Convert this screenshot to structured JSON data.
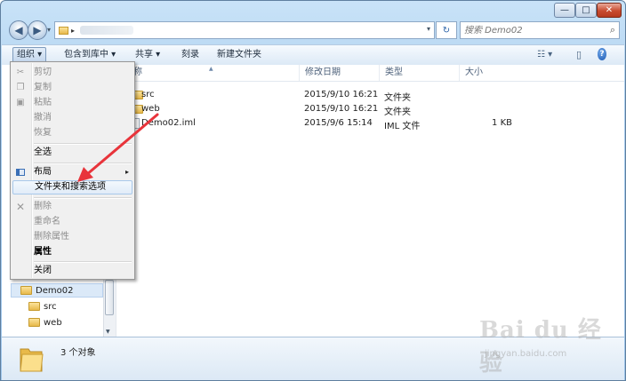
{
  "window": {
    "minimize_glyph": "—",
    "maximize_glyph": "□",
    "close_glyph": "✕"
  },
  "address_bar": {
    "path_arrow": "▸",
    "history_dropdown": "▾",
    "refresh_glyph": "↻"
  },
  "search": {
    "placeholder": "搜索 Demo02",
    "icon": "search-icon"
  },
  "toolbar": {
    "organize": "组织 ▾",
    "include_in_library": "包含到库中 ▾",
    "share": "共享 ▾",
    "burn": "刻录",
    "new_folder": "新建文件夹",
    "view_glyph": "☷ ▾",
    "preview_glyph": "▯",
    "help_glyph": "?"
  },
  "columns": {
    "name": "称",
    "date_modified": "修改日期",
    "type": "类型",
    "size": "大小"
  },
  "files": [
    {
      "name": "src",
      "date": "2015/9/10 16:21",
      "type": "文件夹",
      "size": "",
      "icon": "folder-icon"
    },
    {
      "name": "web",
      "date": "2015/9/10 16:21",
      "type": "文件夹",
      "size": "",
      "icon": "folder-icon"
    },
    {
      "name": "Demo02.iml",
      "date": "2015/9/6 15:14",
      "type": "IML 文件",
      "size": "1 KB",
      "icon": "file-icon"
    }
  ],
  "tree": {
    "items": [
      {
        "label": "Demo02",
        "selected": true
      },
      {
        "label": "src"
      },
      {
        "label": "web"
      }
    ]
  },
  "status": {
    "count_text": "3 个对象"
  },
  "menu": {
    "cut": "剪切",
    "copy": "复制",
    "paste": "粘贴",
    "undo": "撤消",
    "redo": "恢复",
    "select_all": "全选",
    "layout": "布局",
    "folder_options": "文件夹和搜索选项",
    "delete": "删除",
    "rename": "重命名",
    "remove_properties": "删除属性",
    "properties": "属性",
    "close": "关闭",
    "submenu_arrow": "▸"
  },
  "watermark": {
    "logo": "Bai du 经验",
    "url": "jingyan.baidu.com"
  },
  "colors": {
    "arrow": "#e8343b",
    "selection_border": "#a8c8ea"
  }
}
